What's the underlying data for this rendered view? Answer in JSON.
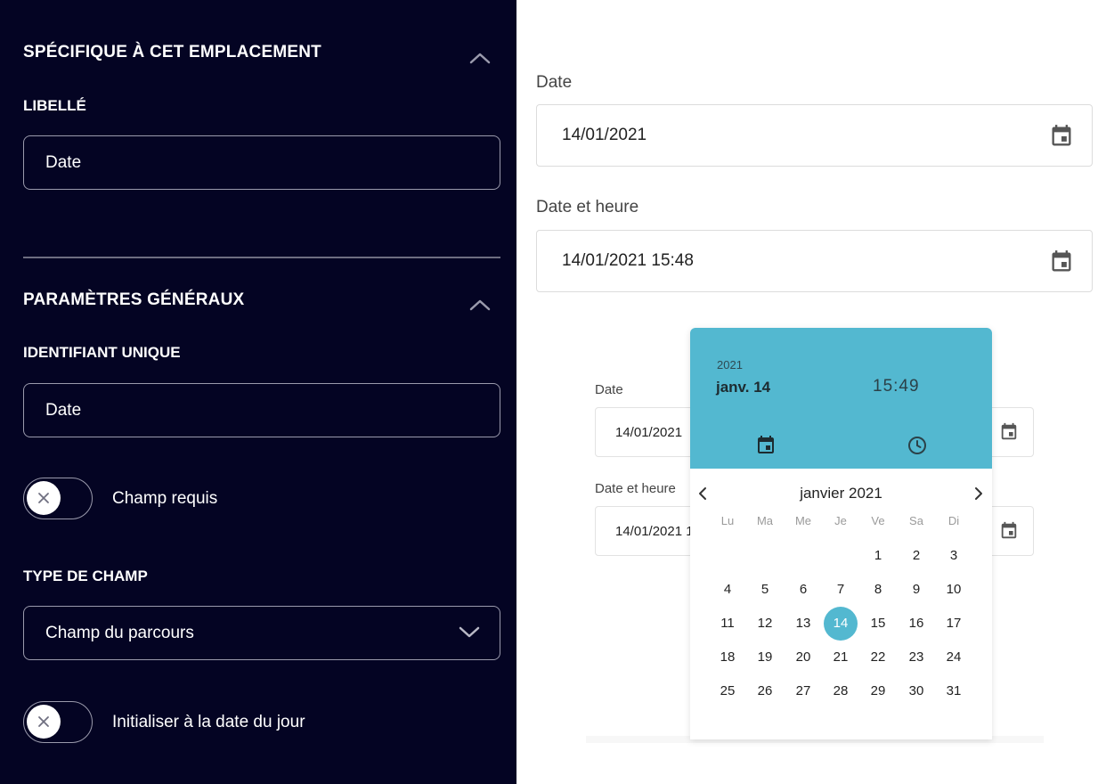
{
  "left_panel": {
    "section1_title": "SPÉCIFIQUE À CET EMPLACEMENT",
    "label_libelle": "LIBELLÉ",
    "libelle_value": "Date",
    "section2_title": "PARAMÈTRES GÉNÉRAUX",
    "label_identifiant": "IDENTIFIANT UNIQUE",
    "identifiant_value": "Date",
    "toggle_required_label": "Champ requis",
    "toggle_required_on": false,
    "label_type": "TYPE DE CHAMP",
    "type_value": "Champ du parcours",
    "toggle_init_label": "Initialiser à la date du jour",
    "toggle_init_on": false
  },
  "preview": {
    "date_label": "Date",
    "date_value": "14/01/2021",
    "datetime_label": "Date et heure",
    "datetime_value": "14/01/2021 15:48",
    "small_date_label": "Date",
    "small_date_value": "14/01/2021",
    "small_datetime_label": "Date et heure",
    "small_datetime_value": "14/01/2021 1"
  },
  "picker": {
    "year": "2021",
    "date": "janv. 14",
    "hour": "15",
    "minute": "49",
    "month_title": "janvier 2021",
    "weekdays": [
      "Lu",
      "Ma",
      "Me",
      "Je",
      "Ve",
      "Sa",
      "Di"
    ],
    "first_weekday_index": 4,
    "days_in_month": 31,
    "selected_day": 14,
    "accent_color": "#53b8d0"
  },
  "colors": {
    "panel_bg": "#040423"
  }
}
